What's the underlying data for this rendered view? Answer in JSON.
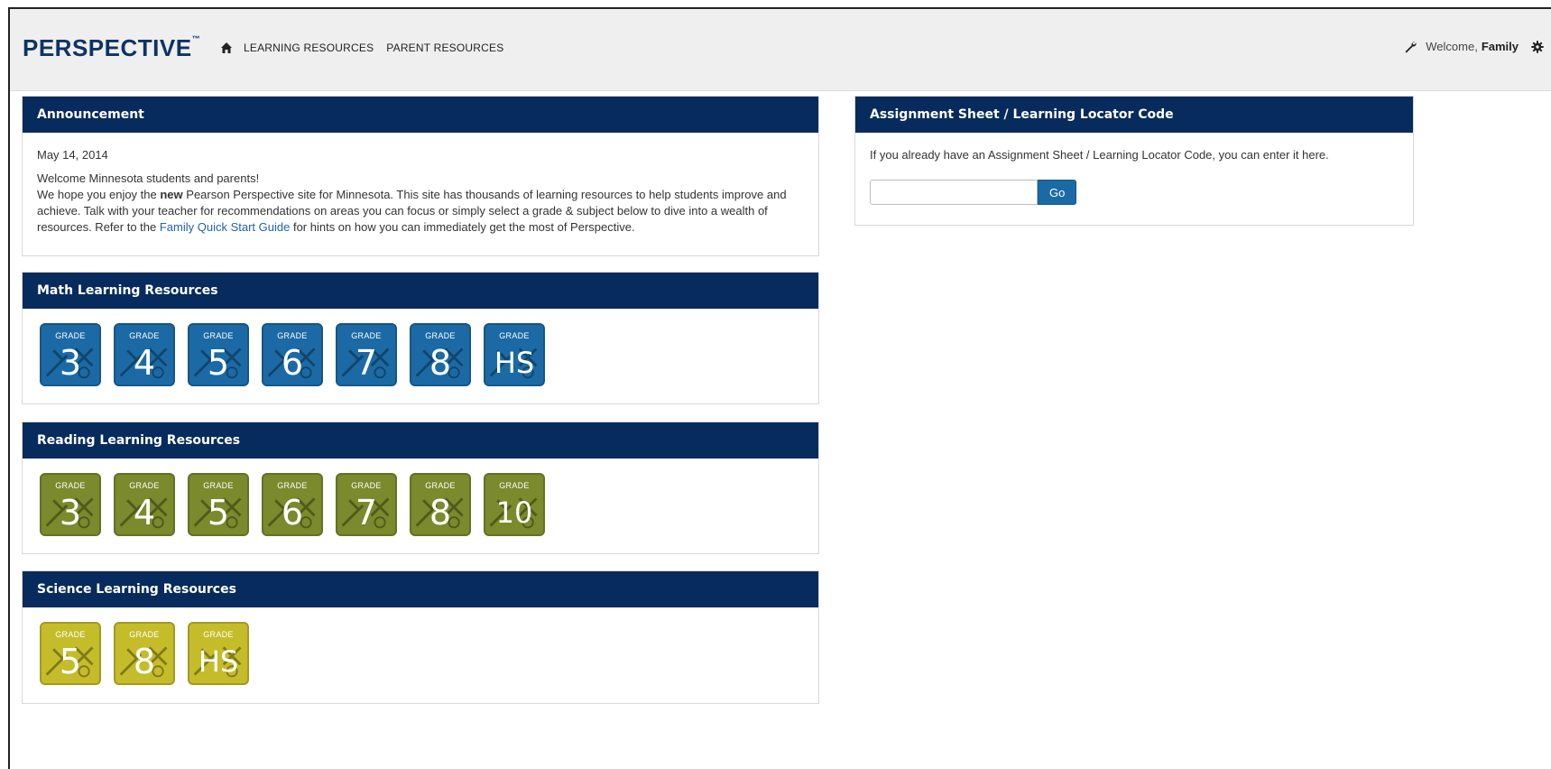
{
  "header": {
    "logo_text": "PERSPECTIVE",
    "logo_tm": "™",
    "nav": [
      {
        "label": "LEARNING RESOURCES"
      },
      {
        "label": "PARENT RESOURCES"
      }
    ],
    "welcome_text": "Welcome,",
    "user_name": "Family"
  },
  "announcement": {
    "title": "Announcement",
    "date": "May 14, 2014",
    "line1": "Welcome Minnesota students and parents!",
    "line2_a": "We hope you enjoy the ",
    "line2_bold": "new",
    "line2_b": " Pearson Perspective site for Minnesota. This site has thousands of learning resources to help students improve and achieve. Talk with your teacher for recommendations on areas you can focus or simply select a grade & subject below to dive into a wealth of resources. Refer to the ",
    "link": "Family Quick Start Guide",
    "line2_c": " for hints on how you can immediately get the most of Perspective."
  },
  "math": {
    "title": "Math Learning Resources",
    "grades": [
      {
        "label": "GRADE",
        "num": "3"
      },
      {
        "label": "GRADE",
        "num": "4"
      },
      {
        "label": "GRADE",
        "num": "5"
      },
      {
        "label": "GRADE",
        "num": "6"
      },
      {
        "label": "GRADE",
        "num": "7"
      },
      {
        "label": "GRADE",
        "num": "8"
      },
      {
        "label": "GRADE",
        "num": "HS"
      }
    ]
  },
  "reading": {
    "title": "Reading Learning Resources",
    "grades": [
      {
        "label": "GRADE",
        "num": "3"
      },
      {
        "label": "GRADE",
        "num": "4"
      },
      {
        "label": "GRADE",
        "num": "5"
      },
      {
        "label": "GRADE",
        "num": "6"
      },
      {
        "label": "GRADE",
        "num": "7"
      },
      {
        "label": "GRADE",
        "num": "8"
      },
      {
        "label": "GRADE",
        "num": "10"
      }
    ]
  },
  "science": {
    "title": "Science Learning Resources",
    "grades": [
      {
        "label": "GRADE",
        "num": "5"
      },
      {
        "label": "GRADE",
        "num": "8"
      },
      {
        "label": "GRADE",
        "num": "HS"
      }
    ]
  },
  "assignment": {
    "title": "Assignment Sheet / Learning Locator Code",
    "intro": "If you already have an Assignment Sheet / Learning Locator Code, you can enter it here.",
    "input_value": "",
    "go_label": "Go"
  },
  "colors": {
    "header_blue": "#062b5c",
    "math_tile": "#1b6aa5",
    "reading_tile": "#7a8a2c",
    "science_tile": "#c5bc2a"
  },
  "icons": [
    "home-icon",
    "wrench-icon",
    "gear-icon"
  ]
}
